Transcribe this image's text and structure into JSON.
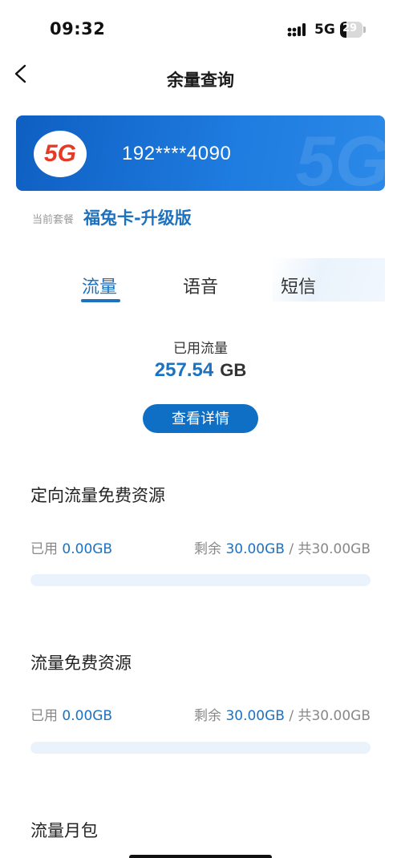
{
  "status_bar": {
    "time": "09:32",
    "network": "5G",
    "battery": "29",
    "battery_level": 0.29
  },
  "header": {
    "title": "余量查询",
    "back_icon": "chevron-left-icon"
  },
  "card": {
    "logo_text": "5G",
    "phone": "192****4090"
  },
  "plan": {
    "label": "当前套餐",
    "name": "福兔卡-升级版"
  },
  "tabs": [
    {
      "label": "流量",
      "active": true
    },
    {
      "label": "语音",
      "active": false
    },
    {
      "label": "短信",
      "active": false
    }
  ],
  "usage": {
    "label": "已用流量",
    "value": "257.54",
    "unit": "GB",
    "detail_button": "查看详情"
  },
  "resources": [
    {
      "title": "定向流量免费资源",
      "used_label": "已用",
      "used_value": "0.00GB",
      "remaining_label": "剩余",
      "remaining_value": "30.00GB",
      "total": "/ 共30.00GB",
      "used_fraction": 0
    },
    {
      "title": "流量免费资源",
      "used_label": "已用",
      "used_value": "0.00GB",
      "remaining_label": "剩余",
      "remaining_value": "30.00GB",
      "total": "/ 共30.00GB",
      "used_fraction": 0
    },
    {
      "title": "流量月包"
    }
  ],
  "colors": {
    "accent": "#1d72c0",
    "card_blue": "#1f7ce0",
    "logo_red": "#e53a26"
  }
}
